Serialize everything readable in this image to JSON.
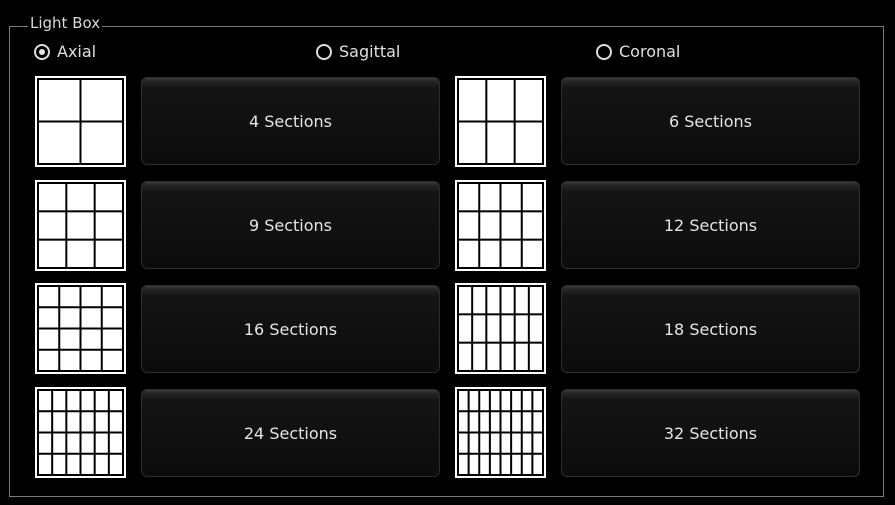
{
  "groupbox": {
    "title": "Light Box"
  },
  "orientation": {
    "selected": "Axial",
    "options": [
      {
        "label": "Axial",
        "checked": true
      },
      {
        "label": "Sagittal",
        "checked": false
      },
      {
        "label": "Coronal",
        "checked": false
      }
    ]
  },
  "layouts": [
    {
      "label": "4 Sections",
      "rows": 2,
      "cols": 2
    },
    {
      "label": "6 Sections",
      "rows": 2,
      "cols": 3
    },
    {
      "label": "9 Sections",
      "rows": 3,
      "cols": 3
    },
    {
      "label": "12 Sections",
      "rows": 3,
      "cols": 4
    },
    {
      "label": "16 Sections",
      "rows": 4,
      "cols": 4
    },
    {
      "label": "18 Sections",
      "rows": 3,
      "cols": 6
    },
    {
      "label": "24 Sections",
      "rows": 4,
      "cols": 6
    },
    {
      "label": "32 Sections",
      "rows": 4,
      "cols": 8
    }
  ],
  "colors": {
    "background": "#000000",
    "grid_line": "#000000",
    "grid_fill": "#ffffff",
    "text": "#e4e4e4"
  }
}
